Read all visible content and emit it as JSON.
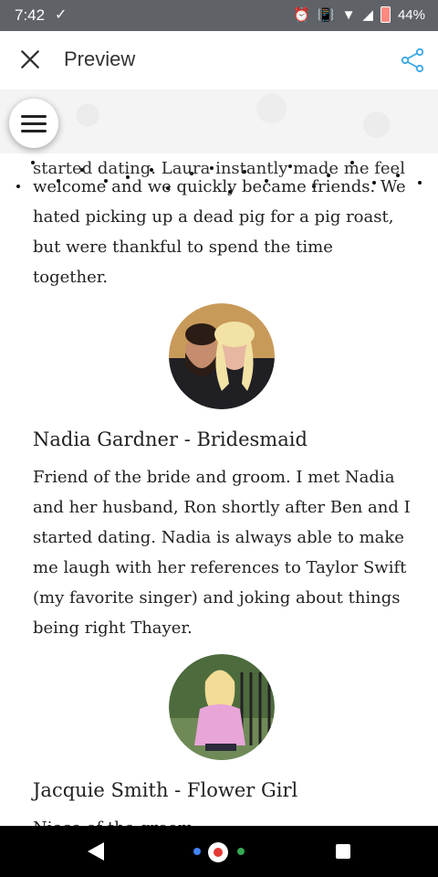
{
  "status": {
    "time": "7:42",
    "check": "✓",
    "battery": "44%"
  },
  "app": {
    "title": "Preview"
  },
  "content": {
    "partial_line": "started dating. Laura instantly made me feel",
    "paragraph1": "welcome and we quickly became friends. We hated picking up a dead pig for a pig roast, but were thankful to spend the time together.",
    "person1": {
      "name": "Nadia Gardner - Bridesmaid",
      "bio": "Friend of the bride and groom. I met Nadia and her husband, Ron shortly after Ben and I started dating. Nadia is always able to make me laugh with her references to Taylor Swift (my favorite singer) and joking about things being right Thayer."
    },
    "person2": {
      "name": "Jacquie Smith - Flower Girl",
      "bio": "Niece of the groom."
    }
  },
  "colors": {
    "share": "#3aa6e8"
  }
}
